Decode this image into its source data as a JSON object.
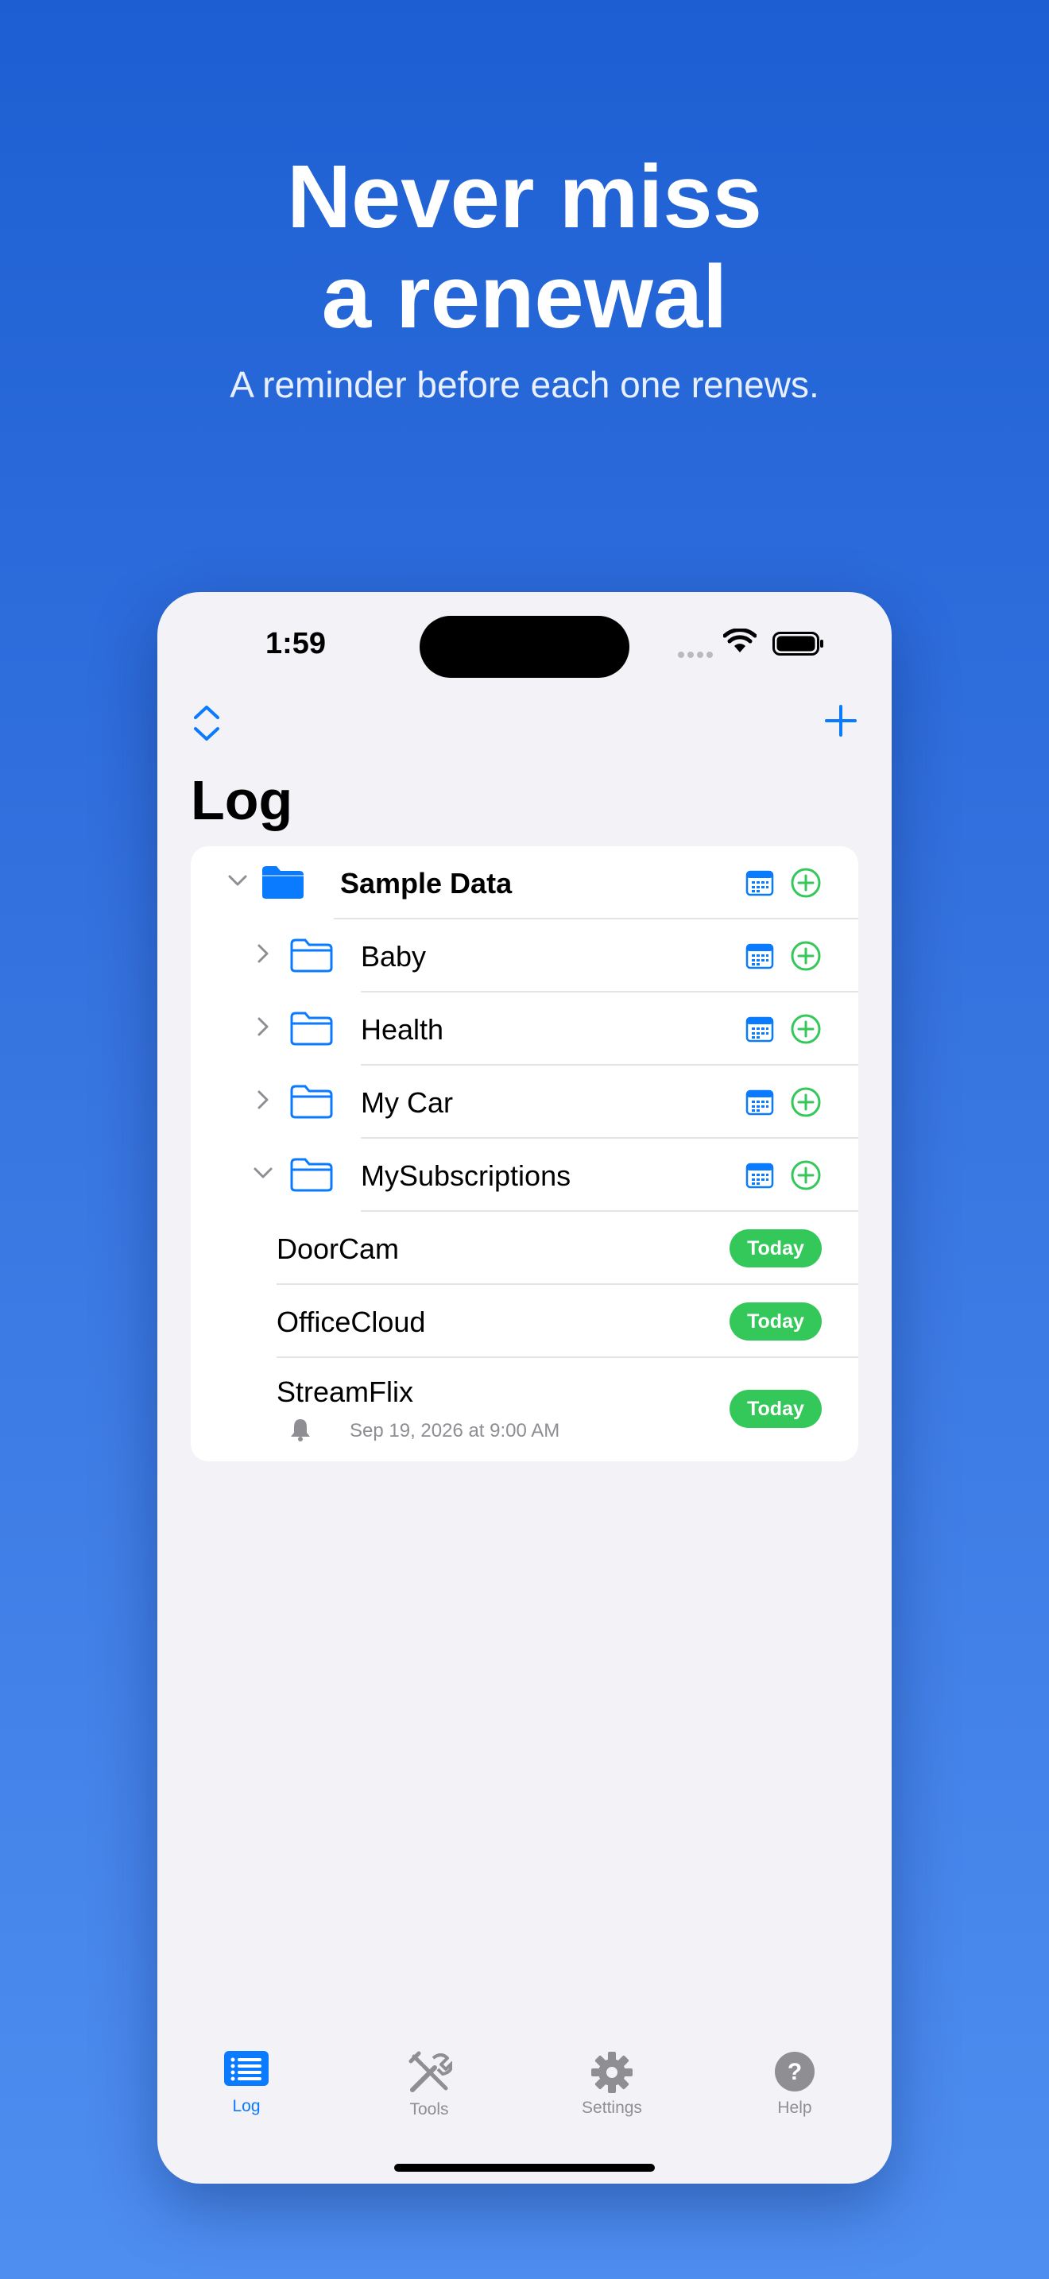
{
  "hero": {
    "title_line1": "Never miss",
    "title_line2": "a renewal",
    "subtitle": "A reminder before each one renews."
  },
  "status_bar": {
    "time": "1:59"
  },
  "nav": {
    "title": "Log"
  },
  "tree": {
    "root": {
      "label": "Sample Data"
    },
    "folders": [
      {
        "label": "Baby"
      },
      {
        "label": "Health"
      },
      {
        "label": "My Car"
      },
      {
        "label": "MySubscriptions"
      }
    ],
    "items": [
      {
        "label": "DoorCam",
        "badge": "Today"
      },
      {
        "label": "OfficeCloud",
        "badge": "Today"
      },
      {
        "label": "StreamFlix",
        "badge": "Today",
        "reminder": "Sep 19, 2026 at 9:00 AM"
      }
    ]
  },
  "tabs": [
    {
      "label": "Log",
      "icon": "log-list-icon",
      "active": true
    },
    {
      "label": "Tools",
      "icon": "tools-icon",
      "active": false
    },
    {
      "label": "Settings",
      "icon": "gear-icon",
      "active": false
    },
    {
      "label": "Help",
      "icon": "help-circle-icon",
      "active": false
    }
  ],
  "colors": {
    "accent": "#0a7aff",
    "success": "#34c759",
    "background_top": "#1d5fd3",
    "background_bottom": "#4e8ef0"
  }
}
